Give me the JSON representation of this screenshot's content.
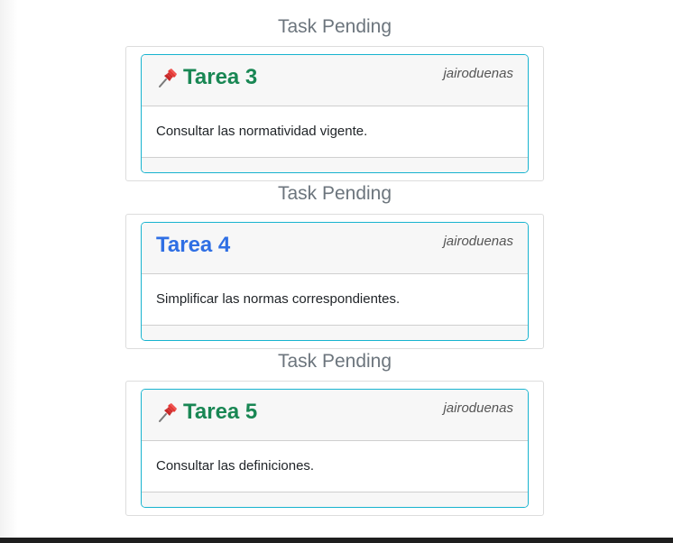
{
  "tasks": [
    {
      "section_title": "Task Pending",
      "title": "Tarea 3",
      "author": "jairoduenas",
      "description": "Consultar las normatividad vigente.",
      "pinned": true
    },
    {
      "section_title": "Task Pending",
      "title": "Tarea 4",
      "author": "jairoduenas",
      "description": "Simplificar las normas correspondientes.",
      "pinned": false
    },
    {
      "section_title": "Task Pending",
      "title": "Tarea 5",
      "author": "jairoduenas",
      "description": "Consultar las definiciones.",
      "pinned": true
    }
  ],
  "icons": {
    "pin": "pushpin-icon"
  },
  "colors": {
    "pinned_title": "#198754",
    "normal_title": "#2f6fe4",
    "card_border": "#17b3cf",
    "section_title": "#6c757d"
  }
}
